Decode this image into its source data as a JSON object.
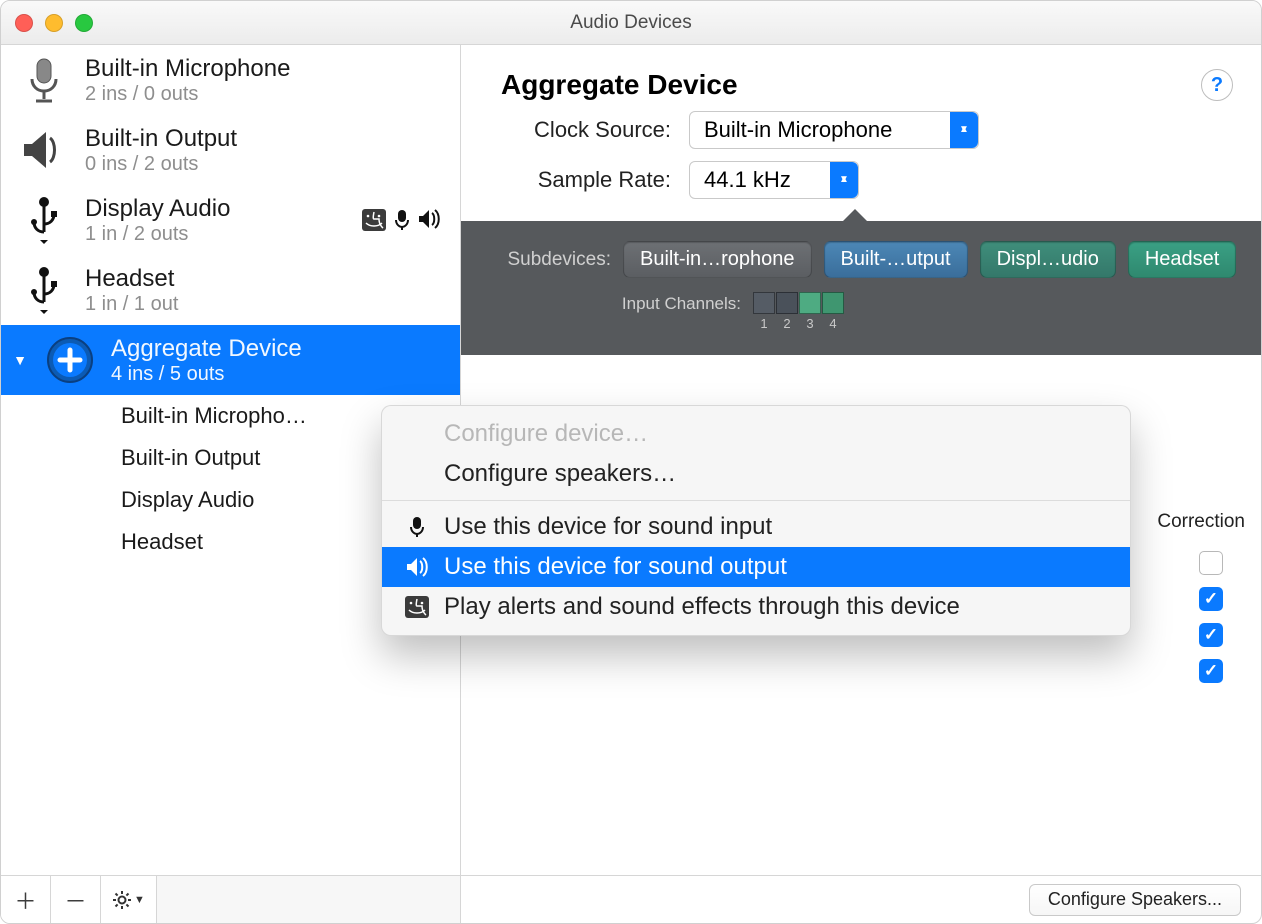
{
  "window": {
    "title": "Audio Devices"
  },
  "sidebar": {
    "devices": [
      {
        "name": "Built-in Microphone",
        "sub": "2 ins / 0 outs",
        "icon": "mic"
      },
      {
        "name": "Built-in Output",
        "sub": "0 ins / 2 outs",
        "icon": "speaker"
      },
      {
        "name": "Display Audio",
        "sub": "1 in / 2 outs",
        "icon": "usb",
        "status": [
          "finder",
          "mic",
          "speaker"
        ]
      },
      {
        "name": "Headset",
        "sub": "1 in / 1 out",
        "icon": "usb"
      },
      {
        "name": "Aggregate Device",
        "sub": "4 ins / 5 outs",
        "icon": "plus",
        "selected": true,
        "children": [
          "Built-in Micropho…",
          "Built-in Output",
          "Display Audio",
          "Headset"
        ]
      }
    ]
  },
  "detail": {
    "title": "Aggregate Device",
    "clock_label": "Clock Source:",
    "clock_value": "Built-in Microphone",
    "rate_label": "Sample Rate:",
    "rate_value": "44.1 kHz",
    "subdevices_label": "Subdevices:",
    "subdevices": [
      "Built-in…rophone",
      "Built-…utput",
      "Displ…udio",
      "Headset"
    ],
    "input_channels_label": "Input Channels:",
    "channel_numbers": [
      "1",
      "2",
      "3",
      "4"
    ],
    "drift_header": "Correction",
    "drift_checks": [
      false,
      true,
      true,
      true
    ]
  },
  "context_menu": {
    "items": [
      {
        "label": "Configure device…",
        "icon": null,
        "state": "disabled"
      },
      {
        "label": "Configure speakers…",
        "icon": null,
        "state": "normal"
      },
      {
        "sep": true
      },
      {
        "label": "Use this device for sound input",
        "icon": "mic",
        "state": "normal"
      },
      {
        "label": "Use this device for sound output",
        "icon": "speaker",
        "state": "highlight"
      },
      {
        "label": "Play alerts and sound effects through this device",
        "icon": "finder",
        "state": "normal"
      }
    ]
  },
  "footer": {
    "configure_speakers": "Configure Speakers..."
  }
}
